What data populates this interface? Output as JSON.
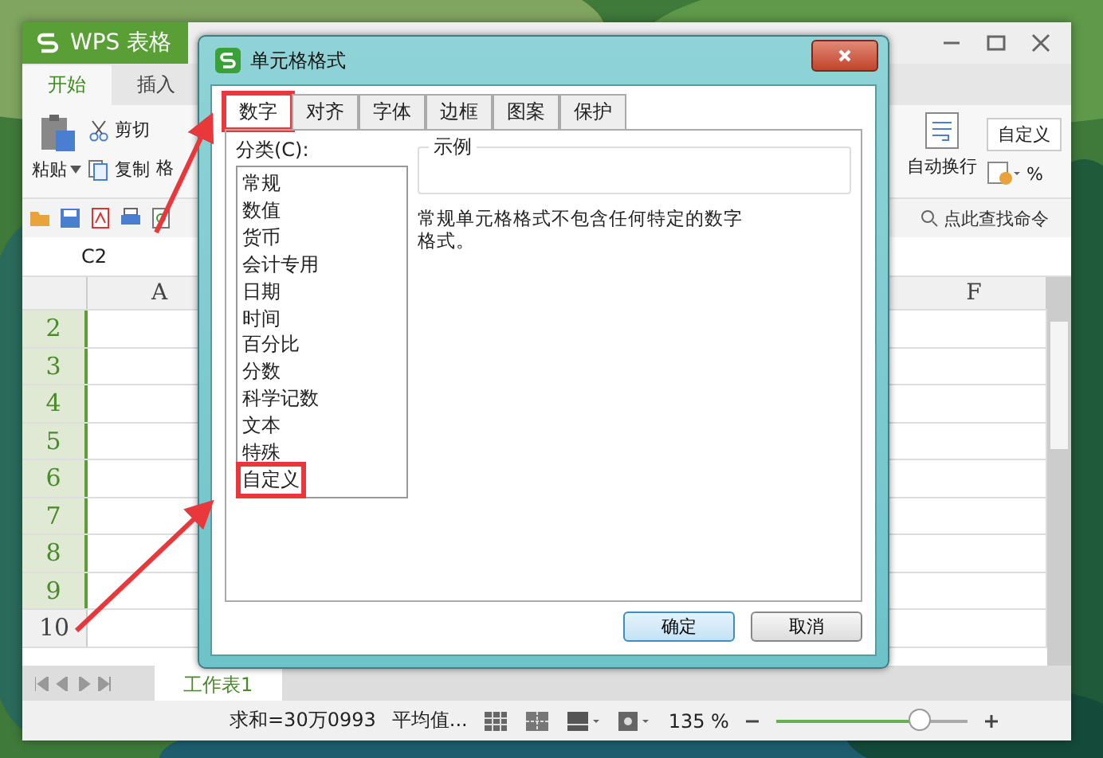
{
  "app": {
    "title": "WPS 表格",
    "ribbon_tabs": [
      {
        "label": "开始",
        "selected": true
      },
      {
        "label": "插入",
        "selected": false
      }
    ],
    "ribbon": {
      "paste": "粘贴",
      "cut": "剪切",
      "copy": "复制",
      "format_painter": "格",
      "wrap_text": "自动换行",
      "number_format": "自定义",
      "percent": "%"
    },
    "search": {
      "placeholder": "点此查找命令"
    },
    "name_box": "C2",
    "columns": [
      "A",
      "F"
    ],
    "rows": [
      {
        "label": "2",
        "selected": true
      },
      {
        "label": "3",
        "selected": true
      },
      {
        "label": "4",
        "selected": true
      },
      {
        "label": "5",
        "selected": true
      },
      {
        "label": "6",
        "selected": true
      },
      {
        "label": "7",
        "selected": true
      },
      {
        "label": "8",
        "selected": true
      },
      {
        "label": "9",
        "selected": true
      },
      {
        "label": "10",
        "selected": false
      }
    ],
    "sheet_tabs": [
      {
        "label": "工作表1",
        "selected": true
      }
    ],
    "status_bar": {
      "sum": "求和=30万0993",
      "average": "平均值...",
      "zoom": "135 %",
      "zoom_slider": {
        "level": 0.75
      }
    }
  },
  "dialog": {
    "title": "单元格格式",
    "tabs": [
      {
        "label": "数字",
        "selected": true,
        "highlighted": true
      },
      {
        "label": "对齐",
        "selected": false,
        "highlighted": false
      },
      {
        "label": "字体",
        "selected": false,
        "highlighted": false
      },
      {
        "label": "边框",
        "selected": false,
        "highlighted": false
      },
      {
        "label": "图案",
        "selected": false,
        "highlighted": false
      },
      {
        "label": "保护",
        "selected": false,
        "highlighted": false
      }
    ],
    "category_label": "分类(C):",
    "categories": [
      {
        "label": "常规",
        "highlighted": false
      },
      {
        "label": "数值",
        "highlighted": false
      },
      {
        "label": "货币",
        "highlighted": false
      },
      {
        "label": "会计专用",
        "highlighted": false
      },
      {
        "label": "日期",
        "highlighted": false
      },
      {
        "label": "时间",
        "highlighted": false
      },
      {
        "label": "百分比",
        "highlighted": false
      },
      {
        "label": "分数",
        "highlighted": false
      },
      {
        "label": "科学记数",
        "highlighted": false
      },
      {
        "label": "文本",
        "highlighted": false
      },
      {
        "label": "特殊",
        "highlighted": false
      },
      {
        "label": "自定义",
        "highlighted": true
      }
    ],
    "sample_label": "示例",
    "description": "常规单元格格式不包含任何特定的数字格式。",
    "buttons": [
      {
        "label": "确定",
        "kind": "default"
      },
      {
        "label": "取消",
        "kind": "normal"
      }
    ]
  }
}
